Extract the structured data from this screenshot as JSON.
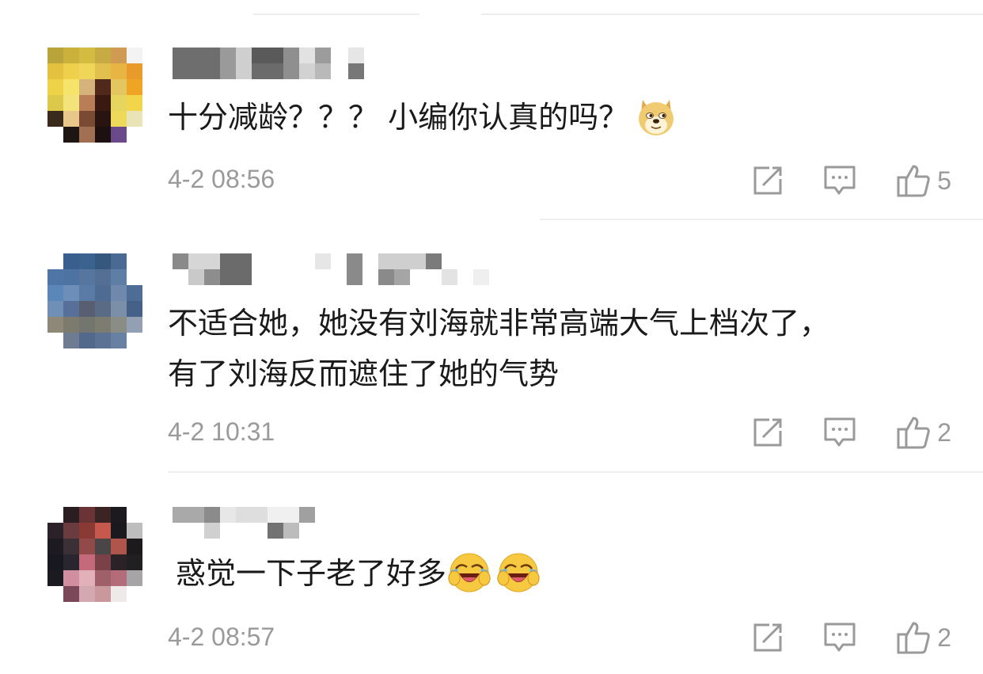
{
  "colors": {
    "text": "#1a1a1a",
    "meta": "#9a9a9a",
    "divider": "#eeeeee"
  },
  "comments": [
    {
      "avatar": "pixelated-avatar",
      "username": "",
      "text": "十分减龄？？？ 小编你认真的吗？",
      "emoji": [
        "doge-emoji"
      ],
      "time": "4-2 08:56",
      "likes": "5"
    },
    {
      "avatar": "pixelated-avatar",
      "username": "",
      "text_lines": [
        "不适合她，她没有刘海就非常高端大气上档次了，",
        "有了刘海反而遮住了她的气势"
      ],
      "emoji": [],
      "time": "4-2 10:31",
      "likes": "2"
    },
    {
      "avatar": "pixelated-avatar",
      "username": "",
      "text": "惑觉一下子老了好多",
      "emoji": [
        "laugh-cry-emoji",
        "laugh-cry-emoji"
      ],
      "time": "4-2 08:57",
      "likes": "2"
    }
  ]
}
